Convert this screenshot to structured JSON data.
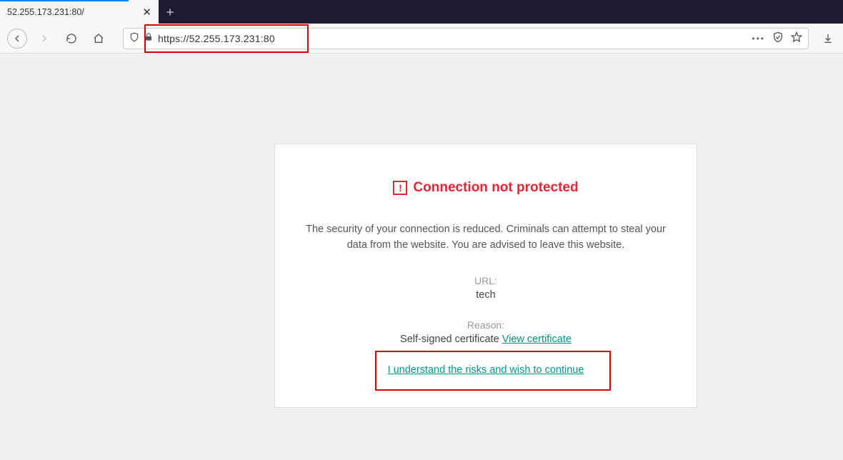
{
  "tab": {
    "title": "52.255.173.231:80/"
  },
  "urlbar": {
    "address": "https://52.255.173.231:80",
    "ellipsis": "•••"
  },
  "warning": {
    "title": "Connection not protected",
    "body": "The security of your connection is reduced. Criminals can attempt to steal your data from the website. You are advised to leave this website.",
    "url_label": "URL:",
    "url_value": "tech",
    "reason_label": "Reason:",
    "reason_text": "Self-signed certificate ",
    "view_cert": "View certificate",
    "continue": "I understand the risks and wish to continue"
  }
}
